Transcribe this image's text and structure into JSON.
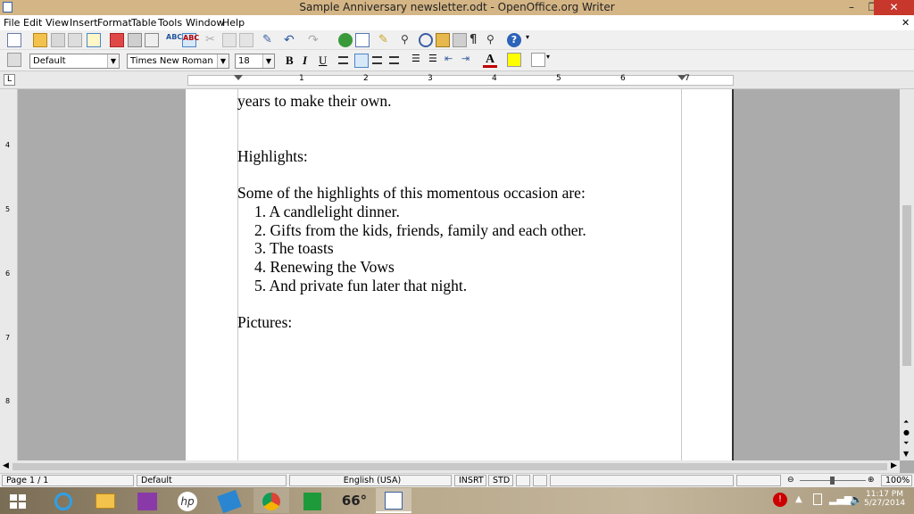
{
  "window": {
    "title": "Sample Anniversary newsletter.odt - OpenOffice.org Writer",
    "minimize": "–",
    "restore": "❐",
    "close": "✕"
  },
  "menu": {
    "items": [
      "File",
      "Edit",
      "View",
      "Insert",
      "Format",
      "Table",
      "Tools",
      "Window",
      "Help"
    ],
    "close_doc": "✕"
  },
  "formatting": {
    "style": "Default",
    "font": "Times New Roman",
    "size": "18",
    "bold": "B",
    "italic": "I",
    "underline": "U"
  },
  "ruler": {
    "numbers": [
      "1",
      "2",
      "3",
      "4",
      "5",
      "6",
      "7"
    ],
    "vertical_numbers": [
      "4",
      "5",
      "6",
      "7",
      "8"
    ],
    "tab_marker": "L"
  },
  "document": {
    "line_top": "years to make their own.",
    "heading_highlights": "Highlights:",
    "intro": "Some of the highlights of this momentous occasion are:",
    "list": [
      "1. A candlelight dinner.",
      "2. Gifts from the kids, friends, family and each other.",
      "3. The toasts",
      "4. Renewing the Vows",
      "5. And private fun later that night."
    ],
    "heading_pictures": "Pictures:"
  },
  "status": {
    "page": "Page 1 / 1",
    "style": "Default",
    "language": "English (USA)",
    "insert_mode": "INSRT",
    "selection_mode": "STD",
    "zoom": "100%"
  },
  "taskbar": {
    "weather": "66°",
    "time": "11:17 PM",
    "date": "5/27/2014"
  },
  "colors": {
    "titlebar": "#d4b585",
    "close": "#c7372b",
    "page": "#ffffff",
    "workspace": "#ababab"
  }
}
